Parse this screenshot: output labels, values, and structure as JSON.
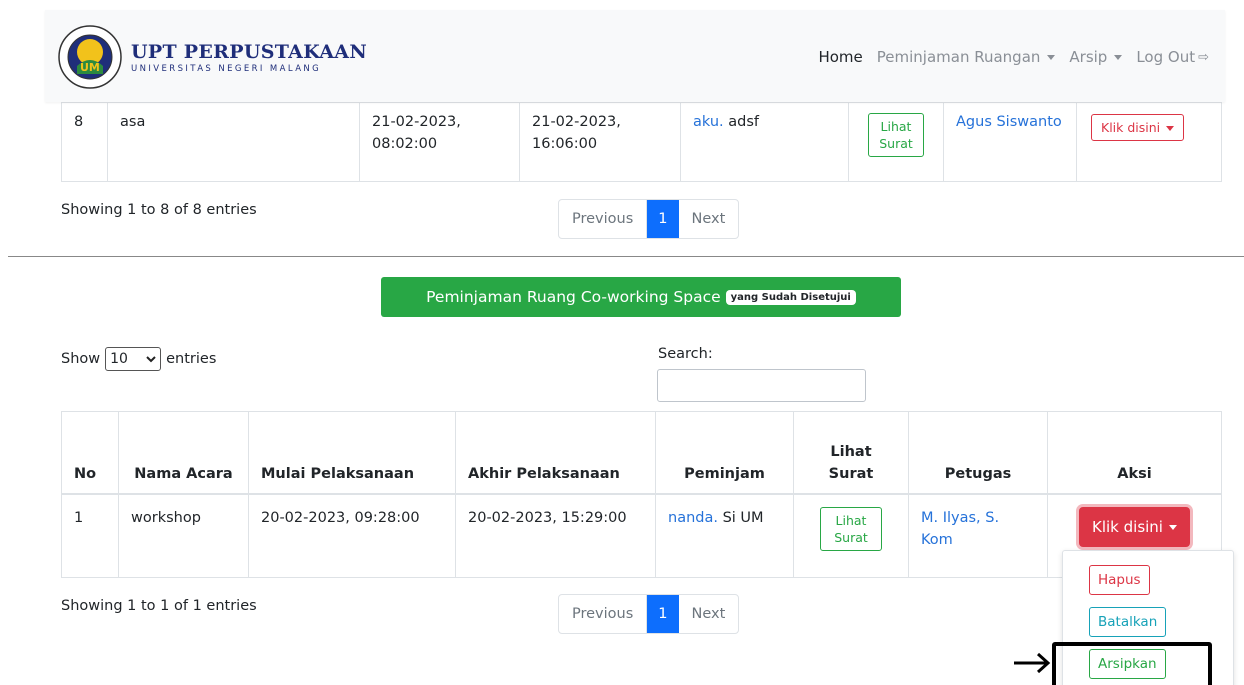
{
  "navbar": {
    "brand_title": "UPT PERPUSTAKAAN",
    "brand_sub": "UNIVERSITAS NEGERI MALANG",
    "logo_text": "UM",
    "items": [
      {
        "label": "Home",
        "active": true
      },
      {
        "label": "Peminjaman Ruangan"
      },
      {
        "label": "Arsip"
      },
      {
        "label": "Log Out"
      }
    ]
  },
  "table1": {
    "row": {
      "no": "8",
      "acara": "asa",
      "mulai": "21-02-2023, 08:02:00",
      "akhir": "21-02-2023, 16:06:00",
      "peminjam_link": "aku.",
      "peminjam_rest": " adsf",
      "lihat_surat": "Lihat Surat",
      "petugas": "Agus Siswanto",
      "aksi": "Klik disini"
    },
    "info": "Showing 1 to 8 of 8 entries",
    "pager": {
      "prev": "Previous",
      "current": "1",
      "next": "Next"
    }
  },
  "section": {
    "title": "Peminjaman Ruang Co-working Space",
    "badge": "yang Sudah Disetujui"
  },
  "controls": {
    "show_label": "Show",
    "show_value": "10",
    "entries_label": "entries",
    "search_label": "Search:",
    "search_value": ""
  },
  "table2": {
    "headers": [
      "No",
      "Nama Acara",
      "Mulai Pelaksanaan",
      "Akhir Pelaksanaan",
      "Peminjam",
      "Lihat Surat",
      "Petugas",
      "Aksi"
    ],
    "row": {
      "no": "1",
      "acara": "workshop",
      "mulai": "20-02-2023, 09:28:00",
      "akhir": "20-02-2023, 15:29:00",
      "peminjam_link": "nanda.",
      "peminjam_rest": " Si UM",
      "lihat_surat": "Lihat Surat",
      "petugas": "M. Ilyas, S. Kom",
      "aksi": "Klik disini"
    },
    "info": "Showing 1 to 1 of 1 entries",
    "pager": {
      "prev": "Previous",
      "current": "1",
      "next": "Next"
    }
  },
  "dropdown": {
    "hapus": "Hapus",
    "batalkan": "Batalkan",
    "arsipkan": "Arsipkan"
  },
  "colors": {
    "green": "#28a745",
    "red": "#dc3545",
    "blue": "#0d6efd",
    "link": "#2672d9"
  }
}
